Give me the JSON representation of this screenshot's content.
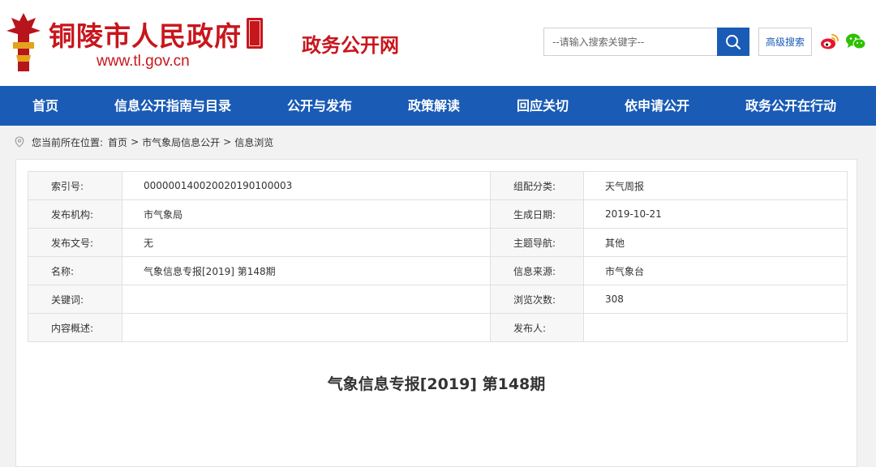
{
  "header": {
    "site_name": "铜陵市人民政府",
    "site_url": "www.tl.gov.cn",
    "section_name": "政务公开网",
    "search": {
      "placeholder": "--请输入搜索关键字--"
    },
    "advanced_search_label": "高级搜索",
    "brand_color": "#c8161d"
  },
  "nav": {
    "color": "#1a5bb5",
    "items": [
      {
        "label": "首页"
      },
      {
        "label": "信息公开指南与目录"
      },
      {
        "label": "公开与发布"
      },
      {
        "label": "政策解读"
      },
      {
        "label": "回应关切"
      },
      {
        "label": "依申请公开"
      },
      {
        "label": "政务公开在行动"
      }
    ]
  },
  "breadcrumb": {
    "prefix": "您当前所在位置:",
    "items": [
      "首页",
      "市气象局信息公开",
      "信息浏览"
    ],
    "separator": ">"
  },
  "meta": {
    "rows": [
      {
        "label1": "索引号:",
        "value1": "000000140020020190100003",
        "label2": "组配分类:",
        "value2": "天气周报"
      },
      {
        "label1": "发布机构:",
        "value1": "市气象局",
        "label2": "生成日期:",
        "value2": "2019-10-21"
      },
      {
        "label1": "发布文号:",
        "value1": "无",
        "label2": "主题导航:",
        "value2": "其他"
      },
      {
        "label1": "名称:",
        "value1": "气象信息专报[2019] 第148期",
        "label2": "信息来源:",
        "value2": "市气象台"
      },
      {
        "label1": "关键词:",
        "value1": "",
        "label2": "浏览次数:",
        "value2": "308"
      },
      {
        "label1": "内容概述:",
        "value1": "",
        "label2": "发布人:",
        "value2": ""
      }
    ]
  },
  "document": {
    "title": "气象信息专报[2019] 第148期"
  }
}
